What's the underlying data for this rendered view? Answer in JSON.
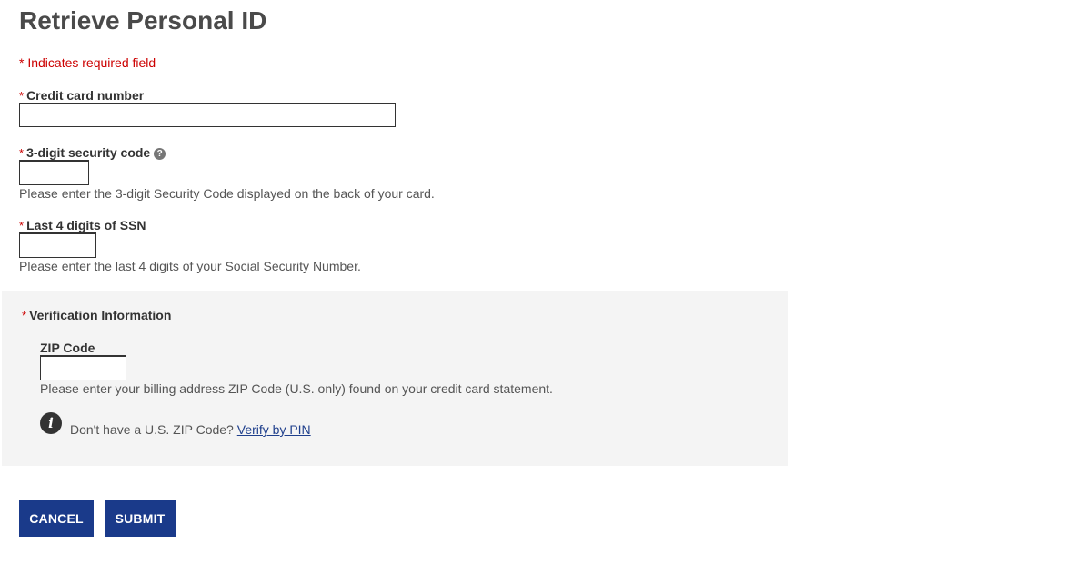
{
  "page": {
    "title": "Retrieve Personal ID",
    "required_note": "* Indicates required field",
    "required_star": "*"
  },
  "credit_card": {
    "label": "Credit card number",
    "value": ""
  },
  "security_code": {
    "label": "3-digit security code",
    "help_icon": "?",
    "value": "",
    "hint": "Please enter the 3-digit Security Code displayed on the back of your card."
  },
  "ssn": {
    "label": "Last 4 digits of SSN",
    "value": "",
    "hint": "Please enter the last 4 digits of your Social Security Number."
  },
  "verification": {
    "heading": "Verification Information",
    "zip_label": "ZIP Code",
    "zip_value": "",
    "zip_hint": "Please enter your billing address ZIP Code (U.S. only) found on your credit card statement.",
    "info_icon": "i",
    "no_zip_text": "Don't have a U.S. ZIP Code?",
    "verify_link": "Verify by PIN"
  },
  "buttons": {
    "cancel": "CANCEL",
    "submit": "SUBMIT"
  },
  "colors": {
    "required": "#cc0000",
    "button_bg": "#1a3a8a",
    "link": "#1f3f8c",
    "panel_bg": "#f4f4f4"
  }
}
